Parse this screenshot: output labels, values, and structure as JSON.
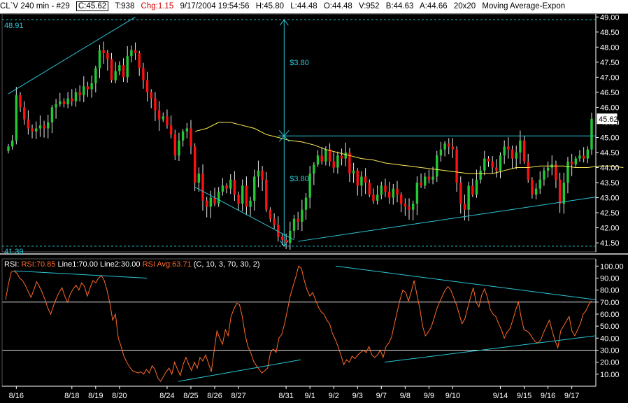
{
  "header": {
    "symbol": "CL`V 240 min - #29",
    "close": "C:45.62",
    "ticks": "T:938",
    "change": "Chg:1.15",
    "datetime": "9/17/2004 19:54:56",
    "high": "H:45.80",
    "low": "L:44.48",
    "open_label": "O:44.48",
    "volume": "V:952",
    "bid": "B:44.63",
    "ask": "A:44.66",
    "grid": "20x20",
    "study": "Moving Average-Expon"
  },
  "price_panel": {
    "top_level_label": "48.91",
    "bottom_level_label": "41.39",
    "current_price_label": "45.62",
    "measure_label_top": "$3.80",
    "measure_label_bottom": "$3.80"
  },
  "rsi_panel": {
    "name": "RSI:",
    "value": "RSI:70.85",
    "line1": "Line1:70.00",
    "line2": "Line2:30.00",
    "avg": "RSI Avg:63.71",
    "params": "(C, 10, 3, 70, 30, 2)"
  },
  "colors": {
    "background": "#000000",
    "up_candle": "#22c933",
    "down_candle": "#ff1010",
    "moving_average": "#ffee55",
    "trendline": "#2bc6d6",
    "rsi_line": "#ff6a2a",
    "rsi_levels": "#e0e0e0",
    "axis": "#ffffff"
  },
  "chart_data": [
    {
      "type": "candlestick",
      "y_axis_ticks": [
        "49.00",
        "48.50",
        "48.00",
        "47.50",
        "47.00",
        "46.50",
        "46.00",
        "45.50",
        "45.00",
        "44.50",
        "44.00",
        "43.50",
        "43.00",
        "42.50",
        "42.00",
        "41.50"
      ],
      "ylim": [
        41.2,
        49.1
      ],
      "x_tick_labels": [
        "8/16",
        "8/18",
        "8/19",
        "8/20",
        "8/24",
        "8/25",
        "8/26",
        "8/27",
        "8/31",
        "9/1",
        "9/2",
        "9/3",
        "9/7",
        "9/8",
        "9/9",
        "9/10",
        "9/14",
        "9/15",
        "9/16",
        "9/17"
      ],
      "x_tick_index": [
        2,
        16,
        22,
        28,
        40,
        46,
        52,
        58,
        70,
        76,
        82,
        88,
        94,
        100,
        106,
        112,
        124,
        130,
        136,
        142
      ],
      "close": [
        44.7,
        44.9,
        46.4,
        46.0,
        45.6,
        45.3,
        45.2,
        45.3,
        45.4,
        45.3,
        45.5,
        46.0,
        46.1,
        46.2,
        46.1,
        46.3,
        46.2,
        46.5,
        46.4,
        46.7,
        46.6,
        46.8,
        47.3,
        47.9,
        47.8,
        47.6,
        46.9,
        47.2,
        47.4,
        47.0,
        47.7,
        47.9,
        47.8,
        47.3,
        46.9,
        46.5,
        46.3,
        45.9,
        45.6,
        45.7,
        45.4,
        45.1,
        44.4,
        44.9,
        45.2,
        45.3,
        44.7,
        43.5,
        43.8,
        42.9,
        42.7,
        43.0,
        42.8,
        43.2,
        43.4,
        43.3,
        43.6,
        43.1,
        42.8,
        43.4,
        42.7,
        42.9,
        43.7,
        43.9,
        43.6,
        42.6,
        42.3,
        42.1,
        41.7,
        41.6,
        41.5,
        41.9,
        42.3,
        42.2,
        42.6,
        43.0,
        43.8,
        44.1,
        44.4,
        44.2,
        44.6,
        44.2,
        44.0,
        44.4,
        44.3,
        44.5,
        43.8,
        43.9,
        43.4,
        43.7,
        43.5,
        43.1,
        42.9,
        43.1,
        43.4,
        43.2,
        43.0,
        43.3,
        43.1,
        42.8,
        42.7,
        42.6,
        42.8,
        43.5,
        43.4,
        43.7,
        43.6,
        43.7,
        44.4,
        44.6,
        44.8,
        44.7,
        44.6,
        43.5,
        42.8,
        42.6,
        43.4,
        43.1,
        43.6,
        43.9,
        44.3,
        44.2,
        44.0,
        43.9,
        44.4,
        44.7,
        44.6,
        44.3,
        44.5,
        44.9,
        44.2,
        43.6,
        43.1,
        43.3,
        43.6,
        43.9,
        44.0,
        44.1,
        43.6,
        42.8,
        43.5,
        44.2,
        44.1,
        44.3,
        44.4,
        44.3,
        44.6,
        45.62
      ],
      "moving_average": [
        45.2,
        45.3,
        45.5,
        45.5,
        45.4,
        45.3,
        45.1,
        45.0,
        44.9,
        44.85,
        44.75,
        44.6,
        44.5,
        44.4,
        44.3,
        44.25,
        44.15,
        44.1,
        44.05,
        44.0,
        43.95,
        43.9,
        43.85,
        43.8,
        43.8,
        43.8,
        43.9,
        44.0,
        44.0,
        44.05,
        44.05,
        44.05,
        44.0,
        44.0,
        44.05,
        44.05,
        44.0
      ],
      "moving_average_start_index": 47,
      "moving_average_step": 3
    },
    {
      "type": "line",
      "title": "RSI",
      "y_axis_ticks": [
        "100.00",
        "90.00",
        "80.00",
        "70.00",
        "60.00",
        "50.00",
        "40.00",
        "30.00",
        "20.00",
        "10.00"
      ],
      "ylim": [
        0,
        106
      ],
      "levels": [
        70,
        30
      ],
      "series": [
        {
          "name": "RSI",
          "values": [
            72,
            85,
            95,
            96,
            94,
            90,
            88,
            84,
            79,
            74,
            80,
            87,
            83,
            78,
            72,
            65,
            60,
            67,
            73,
            78,
            82,
            75,
            70,
            77,
            81,
            84,
            80,
            86,
            83,
            75,
            82,
            88,
            86,
            90,
            92,
            88,
            80,
            69,
            55,
            60,
            40,
            33,
            25,
            20,
            16,
            13,
            12,
            11,
            12,
            10,
            14,
            11,
            17,
            14,
            7,
            4,
            8,
            12,
            15,
            10,
            20,
            14,
            9,
            18,
            24,
            18,
            13,
            20,
            15,
            24,
            21,
            26,
            19,
            12,
            29,
            46,
            40,
            35,
            47,
            42,
            58,
            64,
            69,
            68,
            58,
            43,
            33,
            28,
            21,
            17,
            14,
            11,
            13,
            15,
            28,
            31,
            28,
            40,
            43,
            52,
            63,
            75,
            83,
            91,
            100,
            98,
            88,
            80,
            75,
            78,
            72,
            66,
            62,
            60,
            55,
            52,
            44,
            39,
            33,
            26,
            18,
            22,
            20,
            25,
            23,
            26,
            28,
            30,
            28,
            33,
            26,
            24,
            26,
            30,
            24,
            33,
            36,
            41,
            52,
            62,
            72,
            80,
            78,
            71,
            79,
            88,
            76,
            65,
            50,
            42,
            45,
            49,
            56,
            64,
            70,
            75,
            80,
            83,
            80,
            74,
            68,
            60,
            52,
            56,
            65,
            74,
            82,
            70,
            66,
            76,
            81,
            74,
            64,
            60,
            58,
            52,
            47,
            40,
            45,
            48,
            55,
            63,
            70,
            57,
            47,
            46,
            44,
            40,
            37,
            36,
            39,
            45,
            50,
            55,
            46,
            38,
            32,
            46,
            50,
            54,
            58,
            46,
            42,
            47,
            52,
            60,
            63,
            68,
            71
          ]
        }
      ]
    }
  ]
}
